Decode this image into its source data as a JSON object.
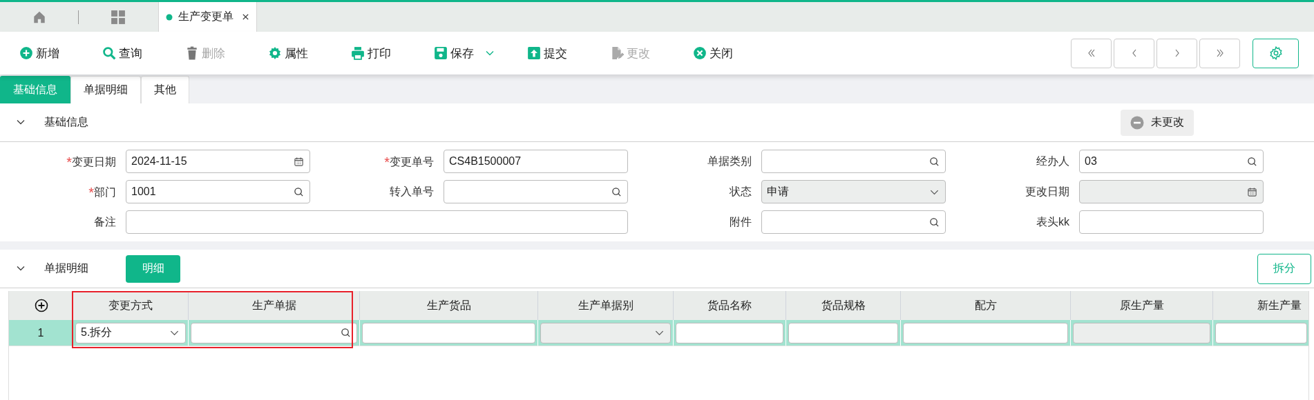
{
  "window_tabs": [
    {
      "kind": "home",
      "selected": false
    },
    {
      "kind": "apps",
      "selected": false
    },
    {
      "kind": "page",
      "label": "生产变更单",
      "selected": true
    }
  ],
  "toolbar": [
    {
      "kind": "add",
      "label": "新增",
      "disabled": false
    },
    {
      "kind": "search",
      "label": "查询",
      "disabled": false
    },
    {
      "kind": "delete",
      "label": "删除",
      "disabled": true
    },
    {
      "kind": "properties",
      "label": "属性",
      "disabled": false
    },
    {
      "kind": "print",
      "label": "打印",
      "disabled": false
    },
    {
      "kind": "save",
      "label": "保存",
      "disabled": false,
      "has_menu": true
    },
    {
      "kind": "submit",
      "label": "提交",
      "disabled": false
    },
    {
      "kind": "edit",
      "label": "更改",
      "disabled": true
    },
    {
      "kind": "close",
      "label": "关闭",
      "disabled": false
    }
  ],
  "record_nav": [
    {
      "kind": "first"
    },
    {
      "kind": "prev"
    },
    {
      "kind": "next"
    },
    {
      "kind": "last"
    }
  ],
  "tabs": [
    {
      "label": "基础信息",
      "selected": true
    },
    {
      "label": "单据明细",
      "selected": false
    },
    {
      "label": "其他",
      "selected": false
    }
  ],
  "header_section": {
    "title": "基础信息",
    "expanded": true,
    "status": "未更改"
  },
  "form_rows": [
    [
      {
        "label": "变更日期",
        "required_mark": "*",
        "kind": "date",
        "value": "2024-11-15",
        "disabled": false
      },
      {
        "label": "变更单号",
        "required_mark": "*",
        "kind": "text",
        "value": "CS4B1500007",
        "disabled": false
      },
      {
        "label": "单据类别",
        "kind": "lookup",
        "disabled": false
      },
      {
        "label": "经办人",
        "kind": "lookup",
        "value": "03",
        "disabled": false
      }
    ],
    [
      {
        "label": "部门",
        "required_mark": "*",
        "kind": "lookup",
        "value": "1001",
        "disabled": false
      },
      {
        "label": "转入单号",
        "kind": "lookup",
        "disabled": false
      },
      {
        "label": "状态",
        "kind": "select",
        "value": "申请",
        "disabled": true
      },
      {
        "label": "更改日期",
        "kind": "date",
        "disabled": true
      }
    ],
    [
      {
        "label": "备注",
        "kind": "text",
        "wide": true,
        "disabled": false
      },
      {
        "label": "附件",
        "kind": "lookup",
        "disabled": false
      },
      {
        "label": "表头kk",
        "kind": "text",
        "disabled": false
      }
    ]
  ],
  "detail_section": {
    "title": "单据明细",
    "expanded": true,
    "detail_button": "明细",
    "split_button": "拆分"
  },
  "table": {
    "columns": [
      {
        "label": "变更方式",
        "highlighted": true
      },
      {
        "label": "生产单据",
        "highlighted": true
      },
      {
        "label": "生产货品",
        "highlighted": false
      },
      {
        "label": "生产单据别",
        "highlighted": false
      },
      {
        "label": "货品名称",
        "highlighted": false
      },
      {
        "label": "货品规格",
        "highlighted": false
      },
      {
        "label": "配方",
        "highlighted": false
      },
      {
        "label": "原生产量",
        "highlighted": false
      },
      {
        "label": "新生产量",
        "highlighted": false
      }
    ],
    "rows": [
      {
        "number": "1",
        "selected": true,
        "cells": [
          {
            "kind": "select",
            "value": "5.拆分",
            "disabled": false
          },
          {
            "kind": "lookup",
            "disabled": false
          },
          {
            "kind": "text",
            "disabled": false
          },
          {
            "kind": "select",
            "disabled": true
          },
          {
            "kind": "text",
            "disabled": false
          },
          {
            "kind": "text",
            "disabled": false
          },
          {
            "kind": "text",
            "disabled": false
          },
          {
            "kind": "text",
            "disabled": true
          },
          {
            "kind": "text",
            "disabled": false
          }
        ]
      }
    ]
  }
}
